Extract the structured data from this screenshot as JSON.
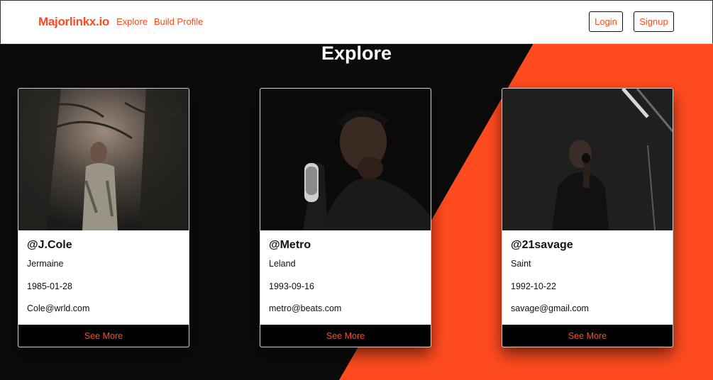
{
  "nav": {
    "brand": "Majorlinkx.io",
    "links": [
      "Explore",
      "Build Profile"
    ],
    "login": "Login",
    "signup": "Signup"
  },
  "page": {
    "title": "Explore"
  },
  "colors": {
    "accent": "#ff4b1f",
    "dark": "#0b0b0c"
  },
  "cards": [
    {
      "handle": "@J.Cole",
      "name": "Jermaine",
      "date": "1985-01-28",
      "email": "Cole@wrld.com",
      "button": "See More"
    },
    {
      "handle": "@Metro",
      "name": "Leland",
      "date": "1993-09-16",
      "email": "metro@beats.com",
      "button": "See More"
    },
    {
      "handle": "@21savage",
      "name": "Saint",
      "date": "1992-10-22",
      "email": "savage@gmail.com",
      "button": "See More"
    }
  ]
}
